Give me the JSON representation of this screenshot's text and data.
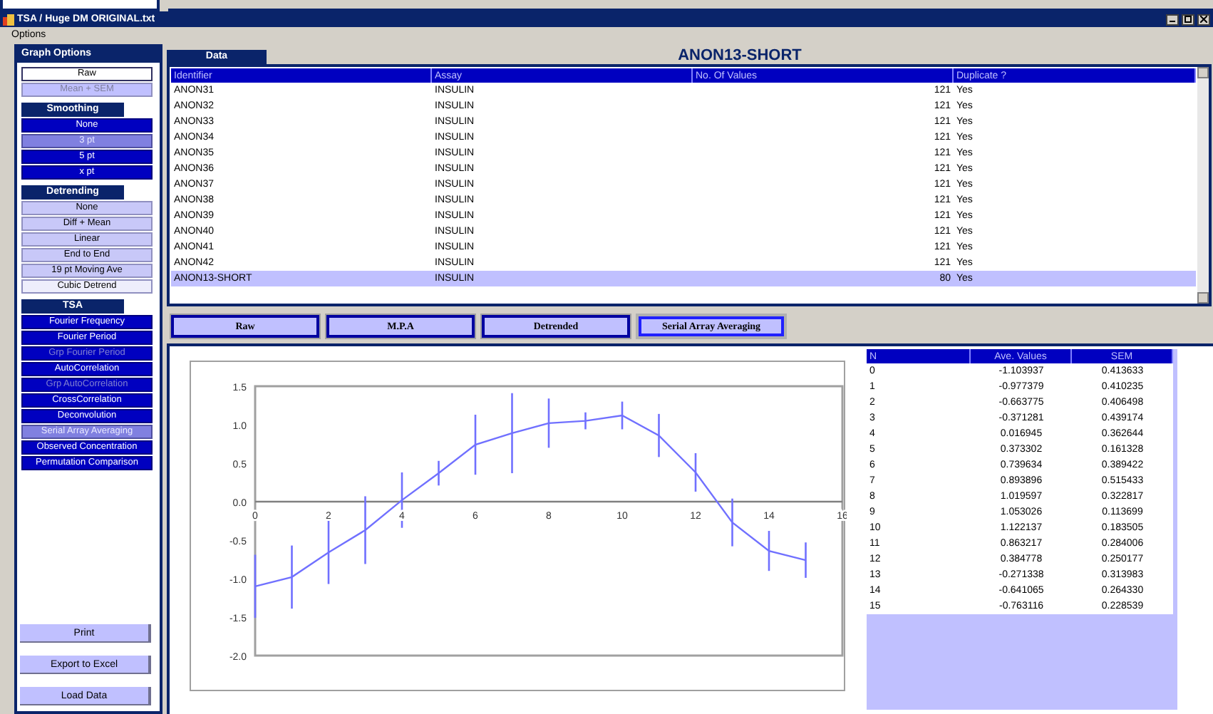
{
  "window": {
    "title": "TSA / Huge DM ORIGINAL.txt"
  },
  "menu": [
    "Options"
  ],
  "sidebar": {
    "title": "Graph Options",
    "groups": [
      {
        "kind": "plain",
        "items": [
          {
            "label": "Raw",
            "selected": true,
            "disabled": false
          },
          {
            "label": "Mean + SEM",
            "selected": false,
            "disabled": true
          }
        ]
      },
      {
        "title": "Smoothing",
        "kind": "dark",
        "items": [
          {
            "label": "None",
            "selected": false,
            "disabled": false
          },
          {
            "label": "3 pt",
            "selected": true,
            "disabled": false
          },
          {
            "label": "5 pt",
            "selected": false,
            "disabled": false
          },
          {
            "label": "x pt",
            "selected": false,
            "disabled": false
          }
        ]
      },
      {
        "title": "Detrending",
        "kind": "light",
        "items": [
          {
            "label": "None",
            "selected": false,
            "disabled": false
          },
          {
            "label": "Diff + Mean",
            "selected": false,
            "disabled": false
          },
          {
            "label": "Linear",
            "selected": false,
            "disabled": false
          },
          {
            "label": "End to End",
            "selected": false,
            "disabled": false
          },
          {
            "label": "19 pt Moving Ave",
            "selected": false,
            "disabled": false
          },
          {
            "label": "Cubic Detrend",
            "selected": true,
            "disabled": false
          }
        ]
      },
      {
        "title": "TSA",
        "kind": "dark",
        "items": [
          {
            "label": "Fourier Frequency",
            "selected": false,
            "disabled": false
          },
          {
            "label": "Fourier Period",
            "selected": false,
            "disabled": false
          },
          {
            "label": "Grp Fourier Period",
            "selected": false,
            "disabled": true
          },
          {
            "label": "AutoCorrelation",
            "selected": false,
            "disabled": false
          },
          {
            "label": "Grp AutoCorrelation",
            "selected": false,
            "disabled": true
          },
          {
            "label": "CrossCorrelation",
            "selected": false,
            "disabled": false
          },
          {
            "label": "Deconvolution",
            "selected": false,
            "disabled": false
          },
          {
            "label": "Serial Array Averaging",
            "selected": true,
            "disabled": false
          },
          {
            "label": "Observed Concentration",
            "selected": false,
            "disabled": false
          },
          {
            "label": "Permutation Comparison",
            "selected": false,
            "disabled": false
          }
        ]
      }
    ],
    "buttons": [
      "Print",
      "Export to Excel",
      "Load Data"
    ]
  },
  "data_tab": "Data",
  "dataset_title": "ANON13-SHORT",
  "table": {
    "columns": [
      "Identifier",
      "Assay",
      "No. Of Values",
      "Duplicate ?"
    ],
    "rows": [
      {
        "cells": [
          "ANON31",
          "INSULIN",
          "121",
          "Yes"
        ],
        "selected": false
      },
      {
        "cells": [
          "ANON32",
          "INSULIN",
          "121",
          "Yes"
        ],
        "selected": false
      },
      {
        "cells": [
          "ANON33",
          "INSULIN",
          "121",
          "Yes"
        ],
        "selected": false
      },
      {
        "cells": [
          "ANON34",
          "INSULIN",
          "121",
          "Yes"
        ],
        "selected": false
      },
      {
        "cells": [
          "ANON35",
          "INSULIN",
          "121",
          "Yes"
        ],
        "selected": false
      },
      {
        "cells": [
          "ANON36",
          "INSULIN",
          "121",
          "Yes"
        ],
        "selected": false
      },
      {
        "cells": [
          "ANON37",
          "INSULIN",
          "121",
          "Yes"
        ],
        "selected": false
      },
      {
        "cells": [
          "ANON38",
          "INSULIN",
          "121",
          "Yes"
        ],
        "selected": false
      },
      {
        "cells": [
          "ANON39",
          "INSULIN",
          "121",
          "Yes"
        ],
        "selected": false
      },
      {
        "cells": [
          "ANON40",
          "INSULIN",
          "121",
          "Yes"
        ],
        "selected": false
      },
      {
        "cells": [
          "ANON41",
          "INSULIN",
          "121",
          "Yes"
        ],
        "selected": false
      },
      {
        "cells": [
          "ANON42",
          "INSULIN",
          "121",
          "Yes"
        ],
        "selected": false
      },
      {
        "cells": [
          "ANON13-SHORT",
          "INSULIN",
          "80",
          "Yes"
        ],
        "selected": true
      }
    ]
  },
  "tabs": [
    {
      "label": "Raw",
      "selected": false
    },
    {
      "label": "M.P.A",
      "selected": false
    },
    {
      "label": "Detrended",
      "selected": false
    },
    {
      "label": "Serial Array Averaging",
      "selected": true
    }
  ],
  "chart_data": {
    "type": "line",
    "x": [
      0,
      1,
      2,
      3,
      4,
      5,
      6,
      7,
      8,
      9,
      10,
      11,
      12,
      13,
      14,
      15
    ],
    "series": [
      {
        "color": "#7070ff",
        "values": [
          -1.1,
          -0.98,
          -0.66,
          -0.37,
          0.02,
          0.37,
          0.74,
          0.89,
          1.02,
          1.05,
          1.12,
          0.86,
          0.38,
          -0.27,
          -0.64,
          -0.76
        ],
        "errors": [
          0.41,
          0.41,
          0.41,
          0.44,
          0.36,
          0.16,
          0.39,
          0.52,
          0.32,
          0.11,
          0.18,
          0.28,
          0.25,
          0.31,
          0.26,
          0.23
        ]
      }
    ],
    "xlim": [
      0,
      16
    ],
    "ylim": [
      -2,
      1.5
    ],
    "xticks": [
      0,
      2,
      4,
      6,
      8,
      10,
      12,
      14,
      16
    ],
    "yticks": [
      {
        "value": 1.5,
        "label": "1.5"
      },
      {
        "value": 1,
        "label": "1.0"
      },
      {
        "value": 0.5,
        "label": "0.5"
      },
      {
        "value": 0,
        "label": "0.0"
      },
      {
        "value": -0.5,
        "label": "-0.5"
      },
      {
        "value": -1,
        "label": "-1.0"
      },
      {
        "value": -1.5,
        "label": "-1.5"
      },
      {
        "value": -2,
        "label": "-2.0"
      }
    ]
  },
  "results": {
    "columns": [
      "N",
      "Ave. Values",
      "SEM"
    ],
    "rows": [
      [
        "0",
        "-1.103937",
        "0.413633"
      ],
      [
        "1",
        "-0.977379",
        "0.410235"
      ],
      [
        "2",
        "-0.663775",
        "0.406498"
      ],
      [
        "3",
        "-0.371281",
        "0.439174"
      ],
      [
        "4",
        "0.016945",
        "0.362644"
      ],
      [
        "5",
        "0.373302",
        "0.161328"
      ],
      [
        "6",
        "0.739634",
        "0.389422"
      ],
      [
        "7",
        "0.893896",
        "0.515433"
      ],
      [
        "8",
        "1.019597",
        "0.322817"
      ],
      [
        "9",
        "1.053026",
        "0.113699"
      ],
      [
        "10",
        "1.122137",
        "0.183505"
      ],
      [
        "11",
        "0.863217",
        "0.284006"
      ],
      [
        "12",
        "0.384778",
        "0.250177"
      ],
      [
        "13",
        "-0.271338",
        "0.313983"
      ],
      [
        "14",
        "-0.641065",
        "0.264330"
      ],
      [
        "15",
        "-0.763116",
        "0.228539"
      ]
    ]
  }
}
